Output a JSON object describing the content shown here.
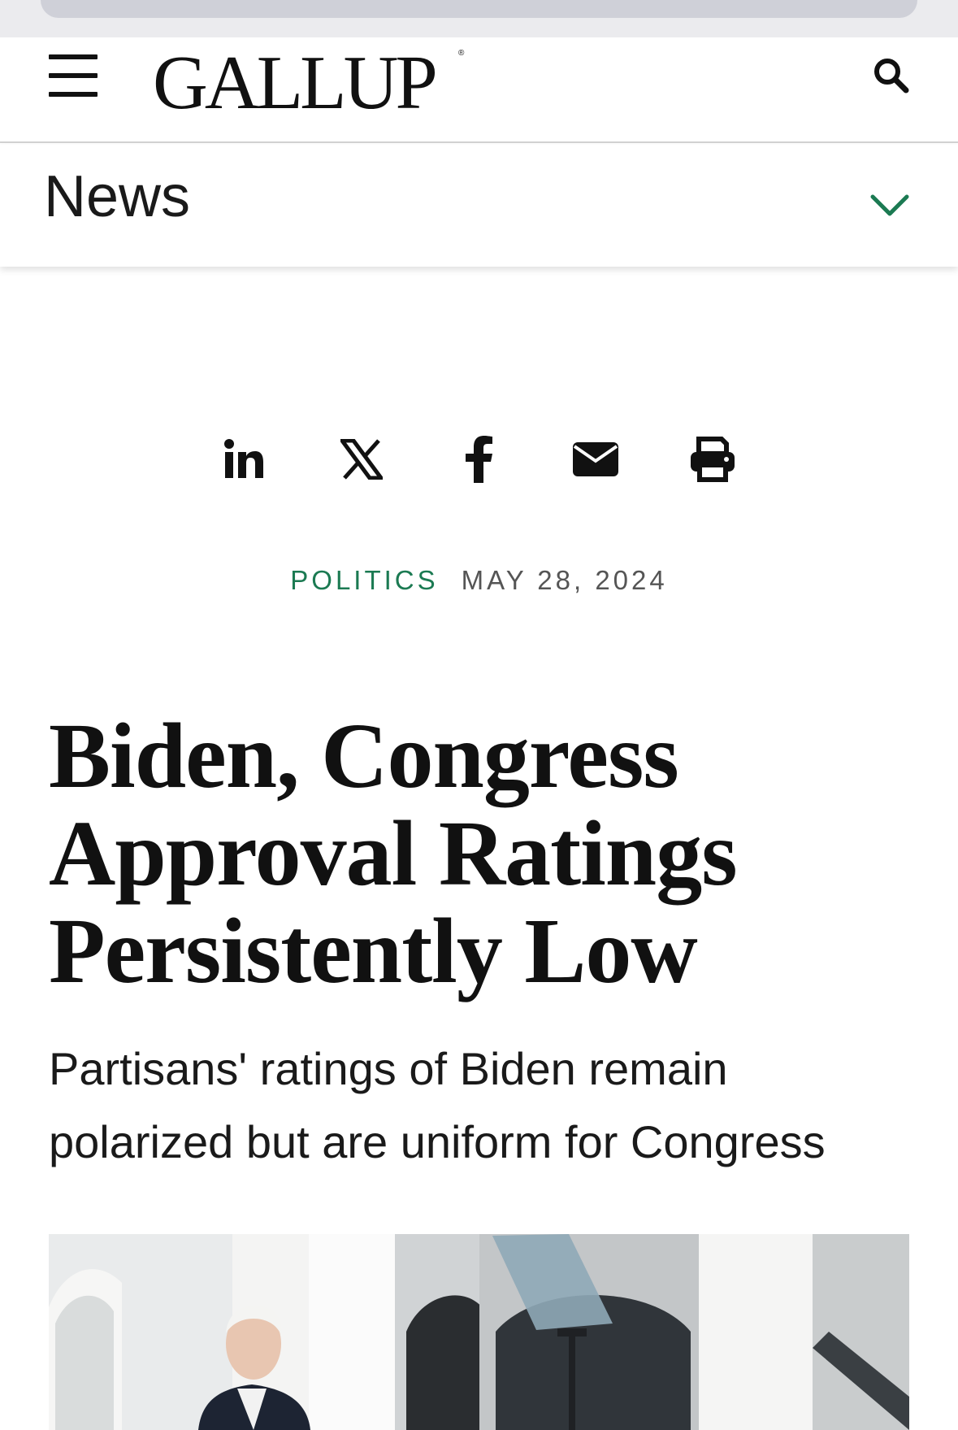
{
  "header": {
    "logo_text": "GALLUP",
    "logo_mark": "®",
    "menu_icon": "hamburger-menu-icon",
    "search_icon": "search-icon"
  },
  "section": {
    "label": "News",
    "toggle_icon": "chevron-down-icon",
    "accent_color": "#1b7a52"
  },
  "share": {
    "items": [
      {
        "icon": "linkedin-icon"
      },
      {
        "icon": "x-twitter-icon"
      },
      {
        "icon": "facebook-icon"
      },
      {
        "icon": "email-icon"
      },
      {
        "icon": "print-icon"
      }
    ]
  },
  "article": {
    "category": "POLITICS",
    "date": "MAY 28, 2024",
    "title_lines": [
      "Biden, Congress",
      "Approval Ratings",
      "Persistently Low"
    ],
    "subtitle_lines": [
      "Partisans' ratings of Biden remain",
      "polarized but are uniform for Congress"
    ]
  },
  "colors": {
    "category": "#1b7a52",
    "date": "#555555",
    "text": "#111111"
  }
}
